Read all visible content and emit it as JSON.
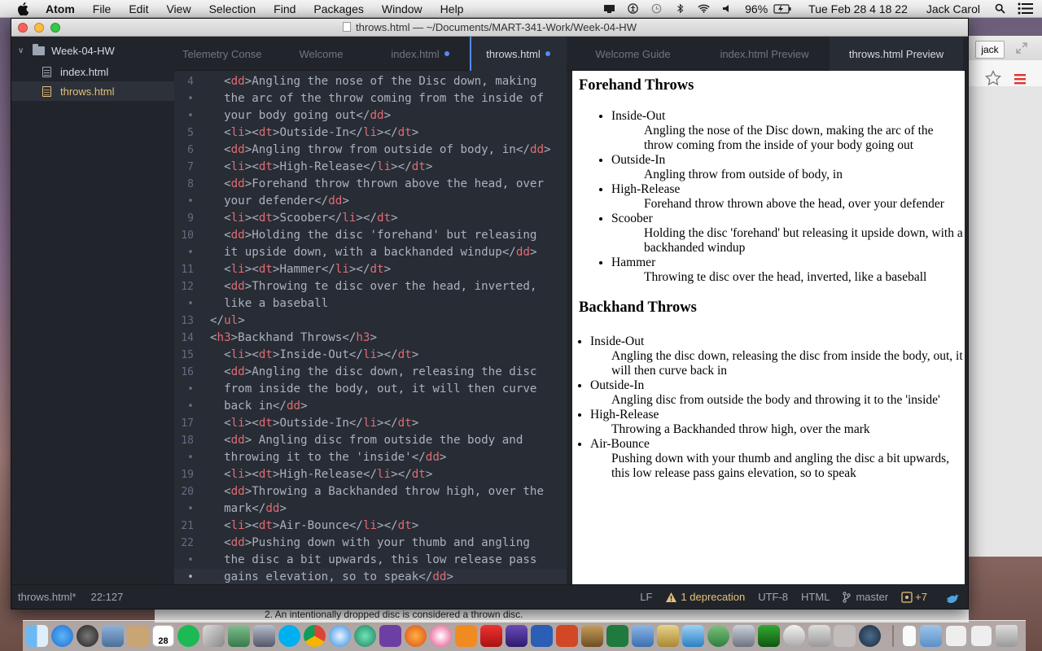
{
  "menubar": {
    "app": "Atom",
    "menus": [
      "File",
      "Edit",
      "View",
      "Selection",
      "Find",
      "Packages",
      "Window",
      "Help"
    ],
    "battery": "96%",
    "clock": "Tue Feb 28  4 18 22",
    "user": "Jack Carol"
  },
  "window": {
    "title": "throws.html — ~/Documents/MART-341-Work/Week-04-HW"
  },
  "tree": {
    "root": "Week-04-HW",
    "files": [
      "index.html",
      "throws.html"
    ]
  },
  "tabs": [
    "Telemetry Conse",
    "Welcome",
    "index.html",
    "throws.html",
    "Welcome Guide",
    "index.html Preview",
    "throws.html Preview"
  ],
  "editor": {
    "lines": [
      {
        "n": "4",
        "parts": [
          [
            "t",
            "  <"
          ],
          [
            "g",
            "dd"
          ],
          [
            "t",
            ">Angling the nose of the Disc down, making"
          ]
        ]
      },
      {
        "n": "•",
        "parts": [
          [
            "t",
            "  the arc of the throw coming from the inside of"
          ]
        ]
      },
      {
        "n": "•",
        "parts": [
          [
            "t",
            "  your body going out</"
          ],
          [
            "g",
            "dd"
          ],
          [
            "t",
            ">"
          ]
        ]
      },
      {
        "n": "5",
        "parts": [
          [
            "t",
            "  <"
          ],
          [
            "g",
            "li"
          ],
          [
            "t",
            "><"
          ],
          [
            "g",
            "dt"
          ],
          [
            "t",
            ">Outside-In</"
          ],
          [
            "g",
            "li"
          ],
          [
            "t",
            "></"
          ],
          [
            "g",
            "dt"
          ],
          [
            "t",
            ">"
          ]
        ]
      },
      {
        "n": "6",
        "parts": [
          [
            "t",
            "  <"
          ],
          [
            "g",
            "dd"
          ],
          [
            "t",
            ">Angling throw from outside of body, in</"
          ],
          [
            "g",
            "dd"
          ],
          [
            "t",
            ">"
          ]
        ]
      },
      {
        "n": "7",
        "parts": [
          [
            "t",
            "  <"
          ],
          [
            "g",
            "li"
          ],
          [
            "t",
            "><"
          ],
          [
            "g",
            "dt"
          ],
          [
            "t",
            ">High-Release</"
          ],
          [
            "g",
            "li"
          ],
          [
            "t",
            "></"
          ],
          [
            "g",
            "dt"
          ],
          [
            "t",
            ">"
          ]
        ]
      },
      {
        "n": "8",
        "parts": [
          [
            "t",
            "  <"
          ],
          [
            "g",
            "dd"
          ],
          [
            "t",
            ">Forehand throw thrown above the head, over"
          ]
        ]
      },
      {
        "n": "•",
        "parts": [
          [
            "t",
            "  your defender</"
          ],
          [
            "g",
            "dd"
          ],
          [
            "t",
            ">"
          ]
        ]
      },
      {
        "n": "9",
        "parts": [
          [
            "t",
            "  <"
          ],
          [
            "g",
            "li"
          ],
          [
            "t",
            "><"
          ],
          [
            "g",
            "dt"
          ],
          [
            "t",
            ">Scoober</"
          ],
          [
            "g",
            "li"
          ],
          [
            "t",
            "></"
          ],
          [
            "g",
            "dt"
          ],
          [
            "t",
            ">"
          ]
        ]
      },
      {
        "n": "10",
        "parts": [
          [
            "t",
            "  <"
          ],
          [
            "g",
            "dd"
          ],
          [
            "t",
            ">Holding the disc 'forehand' but releasing"
          ]
        ]
      },
      {
        "n": "•",
        "parts": [
          [
            "t",
            "  it upside down, with a backhanded windup</"
          ],
          [
            "g",
            "dd"
          ],
          [
            "t",
            ">"
          ]
        ]
      },
      {
        "n": "11",
        "parts": [
          [
            "t",
            "  <"
          ],
          [
            "g",
            "li"
          ],
          [
            "t",
            "><"
          ],
          [
            "g",
            "dt"
          ],
          [
            "t",
            ">Hammer</"
          ],
          [
            "g",
            "li"
          ],
          [
            "t",
            "></"
          ],
          [
            "g",
            "dt"
          ],
          [
            "t",
            ">"
          ]
        ]
      },
      {
        "n": "12",
        "parts": [
          [
            "t",
            "  <"
          ],
          [
            "g",
            "dd"
          ],
          [
            "t",
            ">Throwing te disc over the head, inverted,"
          ]
        ]
      },
      {
        "n": "•",
        "parts": [
          [
            "t",
            "  like a baseball"
          ]
        ]
      },
      {
        "n": "13",
        "parts": [
          [
            "t",
            "</"
          ],
          [
            "g",
            "ul"
          ],
          [
            "t",
            ">"
          ]
        ]
      },
      {
        "n": "14",
        "parts": [
          [
            "t",
            "<"
          ],
          [
            "g",
            "h3"
          ],
          [
            "t",
            ">Backhand Throws</"
          ],
          [
            "g",
            "h3"
          ],
          [
            "t",
            ">"
          ]
        ]
      },
      {
        "n": "15",
        "parts": [
          [
            "t",
            "  <"
          ],
          [
            "g",
            "li"
          ],
          [
            "t",
            "><"
          ],
          [
            "g",
            "dt"
          ],
          [
            "t",
            ">Inside-Out</"
          ],
          [
            "g",
            "li"
          ],
          [
            "t",
            "></"
          ],
          [
            "g",
            "dt"
          ],
          [
            "t",
            ">"
          ]
        ]
      },
      {
        "n": "16",
        "parts": [
          [
            "t",
            "  <"
          ],
          [
            "g",
            "dd"
          ],
          [
            "t",
            ">Angling the disc down, releasing the disc"
          ]
        ]
      },
      {
        "n": "•",
        "parts": [
          [
            "t",
            "  from inside the body, out, it will then curve"
          ]
        ]
      },
      {
        "n": "•",
        "parts": [
          [
            "t",
            "  back in</"
          ],
          [
            "g",
            "dd"
          ],
          [
            "t",
            ">"
          ]
        ]
      },
      {
        "n": "17",
        "parts": [
          [
            "t",
            "  <"
          ],
          [
            "g",
            "li"
          ],
          [
            "t",
            "><"
          ],
          [
            "g",
            "dt"
          ],
          [
            "t",
            ">Outside-In</"
          ],
          [
            "g",
            "li"
          ],
          [
            "t",
            "></"
          ],
          [
            "g",
            "dt"
          ],
          [
            "t",
            ">"
          ]
        ]
      },
      {
        "n": "18",
        "parts": [
          [
            "t",
            "  <"
          ],
          [
            "g",
            "dd"
          ],
          [
            "t",
            "> Angling disc from outside the body and"
          ]
        ]
      },
      {
        "n": "•",
        "parts": [
          [
            "t",
            "  throwing it to the 'inside'</"
          ],
          [
            "g",
            "dd"
          ],
          [
            "t",
            ">"
          ]
        ]
      },
      {
        "n": "19",
        "parts": [
          [
            "t",
            "  <"
          ],
          [
            "g",
            "li"
          ],
          [
            "t",
            "><"
          ],
          [
            "g",
            "dt"
          ],
          [
            "t",
            ">High-Release</"
          ],
          [
            "g",
            "li"
          ],
          [
            "t",
            "></"
          ],
          [
            "g",
            "dt"
          ],
          [
            "t",
            ">"
          ]
        ]
      },
      {
        "n": "20",
        "parts": [
          [
            "t",
            "  <"
          ],
          [
            "g",
            "dd"
          ],
          [
            "t",
            ">Throwing a Backhanded throw high, over the"
          ]
        ]
      },
      {
        "n": "•",
        "parts": [
          [
            "t",
            "  mark</"
          ],
          [
            "g",
            "dd"
          ],
          [
            "t",
            ">"
          ]
        ]
      },
      {
        "n": "21",
        "parts": [
          [
            "t",
            "  <"
          ],
          [
            "g",
            "li"
          ],
          [
            "t",
            "><"
          ],
          [
            "g",
            "dt"
          ],
          [
            "t",
            ">Air-Bounce</"
          ],
          [
            "g",
            "li"
          ],
          [
            "t",
            "></"
          ],
          [
            "g",
            "dt"
          ],
          [
            "t",
            ">"
          ]
        ]
      },
      {
        "n": "22",
        "parts": [
          [
            "t",
            "  <"
          ],
          [
            "g",
            "dd"
          ],
          [
            "t",
            ">Pushing down with your thumb and angling"
          ]
        ]
      },
      {
        "n": "•",
        "parts": [
          [
            "t",
            "  the disc a bit upwards, this low release pass"
          ]
        ]
      },
      {
        "n": "•",
        "parts": [
          [
            "t",
            "  gains elevation, so to speak</"
          ],
          [
            "g",
            "dd"
          ],
          [
            "t",
            ">"
          ]
        ],
        "current": true
      }
    ]
  },
  "preview": {
    "forehand_title": "Forehand Throws",
    "forehand": [
      {
        "dt": "Inside-Out",
        "dd": "Angling the nose of the Disc down, making the arc of the throw coming from the inside of your body going out"
      },
      {
        "dt": "Outside-In",
        "dd": "Angling throw from outside of body, in"
      },
      {
        "dt": "High-Release",
        "dd": "Forehand throw thrown above the head, over your defender"
      },
      {
        "dt": "Scoober",
        "dd": "Holding the disc 'forehand' but releasing it upside down, with a backhanded windup"
      },
      {
        "dt": "Hammer",
        "dd": "Throwing te disc over the head, inverted, like a baseball"
      }
    ],
    "backhand_title": "Backhand Throws",
    "backhand": [
      {
        "dt": "Inside-Out",
        "dd": "Angling the disc down, releasing the disc from inside the body, out, it will then curve back in"
      },
      {
        "dt": "Outside-In",
        "dd": "Angling disc from outside the body and throwing it to the 'inside'"
      },
      {
        "dt": "High-Release",
        "dd": "Throwing a Backhanded throw high, over the mark"
      },
      {
        "dt": "Air-Bounce",
        "dd": "Pushing down with your thumb and angling the disc a bit upwards, this low release pass gains elevation, so to speak"
      }
    ]
  },
  "status": {
    "file": "throws.html*",
    "cursor": "22:127",
    "line_ending": "LF",
    "deprecation": "1 deprecation",
    "encoding": "UTF-8",
    "grammar": "HTML",
    "branch": "master",
    "git_changes": "+7"
  },
  "browser": {
    "user_button": "jack"
  },
  "background_doc": "2.  An intentionally dropped disc is considered a thrown disc.",
  "dock_badge": "28",
  "colors": {
    "accent": "#528bff",
    "tag": "#e06c75",
    "warning": "#e5c07b",
    "editor_bg": "#282c34"
  }
}
